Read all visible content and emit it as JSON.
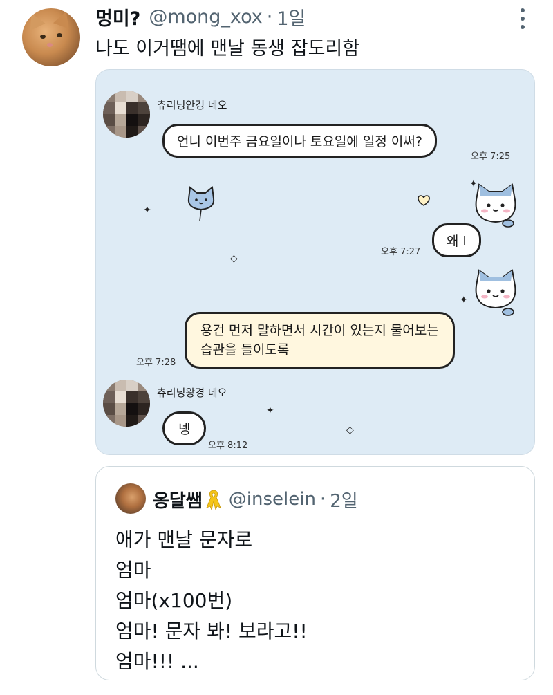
{
  "tweet": {
    "display_name": "멍미?",
    "handle": "@mong_xox",
    "separator": "·",
    "time": "1일",
    "text": "나도 이거땜에 맨날 동생 잡도리함",
    "more_icon": "more-vertical-icon"
  },
  "chat_image": {
    "background_color": "#deebf5",
    "sender_name_1": "츄리닝안경 네오",
    "messages": [
      {
        "side": "left",
        "text": "언니 이번주 금요일이나 토요일에 일정 이써?",
        "time": "오후 7:25"
      },
      {
        "side": "right",
        "text": "왜 l",
        "time": "오후 7:27"
      },
      {
        "side": "right",
        "lines": [
          "용건 먼저 말하면서 시간이 있는지 물어보는",
          "습관을 들이도록"
        ],
        "time": "오후 7:28"
      },
      {
        "side": "left",
        "text": "넹",
        "time": "오후 8:12"
      }
    ],
    "sender_name_2": "츄리닝왕경 네오"
  },
  "quote": {
    "display_name": "옹달쌤",
    "badge_icon": "yellow-ribbon-icon",
    "badge_color": "#f5c518",
    "handle": "@inselein",
    "separator": "·",
    "time": "2일",
    "lines": [
      "애가 맨날 문자로",
      "엄마",
      "엄마(x100번)",
      "엄마! 문자 봐! 보라고!!",
      "엄마!!! ..."
    ]
  }
}
